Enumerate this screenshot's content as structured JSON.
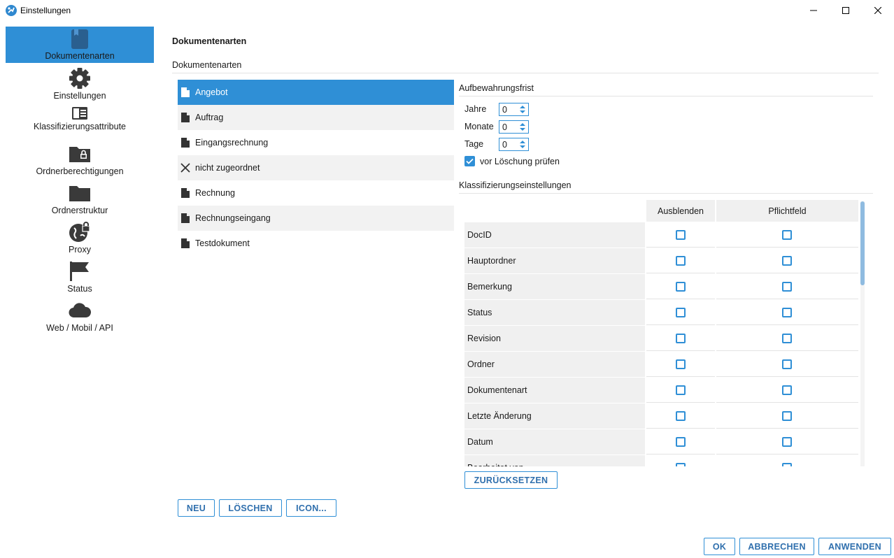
{
  "window": {
    "title": "Einstellungen"
  },
  "sidebar": {
    "items": [
      {
        "label": "Dokumentenarten",
        "icon": "book-icon",
        "active": true
      },
      {
        "label": "Einstellungen",
        "icon": "gear-icon",
        "active": false
      },
      {
        "label": "Klassifizierungsattribute",
        "icon": "card-list-icon",
        "active": false
      },
      {
        "label": "Ordnerberechtigungen",
        "icon": "folder-lock-icon",
        "active": false
      },
      {
        "label": "Ordnerstruktur",
        "icon": "folder-icon",
        "active": false
      },
      {
        "label": "Proxy",
        "icon": "globe-lock-icon",
        "active": false
      },
      {
        "label": "Status",
        "icon": "flag-icon",
        "active": false
      },
      {
        "label": "Web / Mobil / API",
        "icon": "cloud-icon",
        "active": false
      }
    ]
  },
  "main": {
    "page_title": "Dokumentenarten",
    "section_title": "Dokumentenarten",
    "doc_types": [
      {
        "label": "Angebot",
        "icon": "document-icon",
        "selected": true
      },
      {
        "label": "Auftrag",
        "icon": "document-icon",
        "selected": false
      },
      {
        "label": "Eingangsrechnung",
        "icon": "document-icon",
        "selected": false
      },
      {
        "label": "nicht zugeordnet",
        "icon": "x-icon",
        "selected": false
      },
      {
        "label": "Rechnung",
        "icon": "document-icon",
        "selected": false
      },
      {
        "label": "Rechnungseingang",
        "icon": "document-icon",
        "selected": false
      },
      {
        "label": "Testdokument",
        "icon": "document-icon",
        "selected": false
      }
    ],
    "retention": {
      "title": "Aufbewahrungsfrist",
      "fields": [
        {
          "label": "Jahre",
          "value": "0"
        },
        {
          "label": "Monate",
          "value": "0"
        },
        {
          "label": "Tage",
          "value": "0"
        }
      ],
      "check_before_delete": {
        "label": "vor Löschung prüfen",
        "checked": true
      }
    },
    "classification": {
      "title": "Klassifizierungseinstellungen",
      "columns": [
        "",
        "Ausblenden",
        "Pflichtfeld"
      ],
      "rows": [
        {
          "name": "DocID",
          "hide": false,
          "required": false
        },
        {
          "name": "Hauptordner",
          "hide": false,
          "required": false
        },
        {
          "name": "Bemerkung",
          "hide": false,
          "required": false
        },
        {
          "name": "Status",
          "hide": false,
          "required": false
        },
        {
          "name": "Revision",
          "hide": false,
          "required": false
        },
        {
          "name": "Ordner",
          "hide": false,
          "required": false
        },
        {
          "name": "Dokumentenart",
          "hide": false,
          "required": false
        },
        {
          "name": "Letzte Änderung",
          "hide": false,
          "required": false
        },
        {
          "name": "Datum",
          "hide": false,
          "required": false
        },
        {
          "name": "Bearbeitet von",
          "hide": false,
          "required": false
        }
      ],
      "reset_label": "ZURÜCKSETZEN"
    },
    "list_buttons": {
      "new_label": "NEU",
      "delete_label": "LÖSCHEN",
      "icon_label": "ICON..."
    }
  },
  "footer": {
    "ok_label": "OK",
    "cancel_label": "ABBRECHEN",
    "apply_label": "ANWENDEN"
  },
  "colors": {
    "accent": "#2f8fd6",
    "row_alt": "#f2f2f2"
  }
}
